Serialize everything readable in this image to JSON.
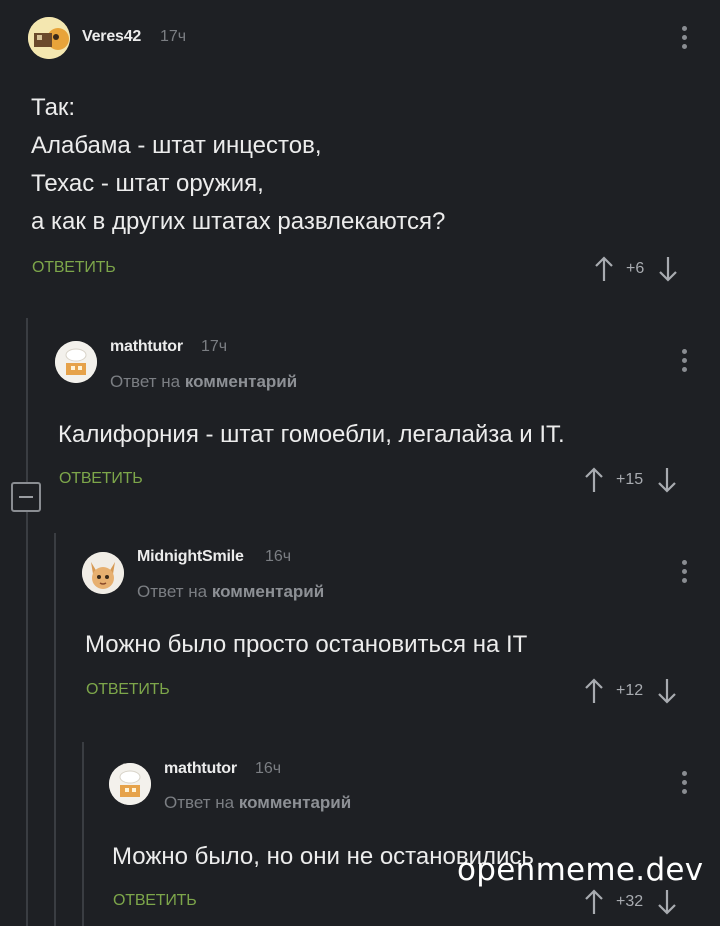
{
  "comments": [
    {
      "author": "Veres42",
      "time": "17ч",
      "reply_prefix": "",
      "reply_link": "",
      "text": "Так:\nАлабама - штат инцестов,\nТехас - штат оружия,\nа как в других штатах развлекаются?",
      "reply_label": "ОТВЕТИТЬ",
      "score": "+6"
    },
    {
      "author": "mathtutor",
      "time": "17ч",
      "reply_prefix": "Ответ на",
      "reply_link": "комментарий",
      "text": "Калифорния - штат гомоебли, легалайза и IT.",
      "reply_label": "ОТВЕТИТЬ",
      "score": "+15"
    },
    {
      "author": "MidnightSmile",
      "time": "16ч",
      "reply_prefix": "Ответ на",
      "reply_link": "комментарий",
      "text": "Можно было просто остановиться на IT",
      "reply_label": "ОТВЕТИТЬ",
      "score": "+12"
    },
    {
      "author": "mathtutor",
      "time": "16ч",
      "reply_prefix": "Ответ на",
      "reply_link": "комментарий",
      "text": "Можно было, но они не остановились",
      "reply_label": "ОТВЕТИТЬ",
      "score": "+32"
    }
  ],
  "watermark": "openmeme.dev",
  "colors": {
    "background": "#1e2024",
    "reply_green": "#7da64a",
    "muted": "#7b7e83",
    "text": "#ececec"
  },
  "icons": [
    "kebab-menu-icon",
    "arrow-up-icon",
    "arrow-down-icon",
    "collapse-minus-icon",
    "avatar-icon"
  ]
}
